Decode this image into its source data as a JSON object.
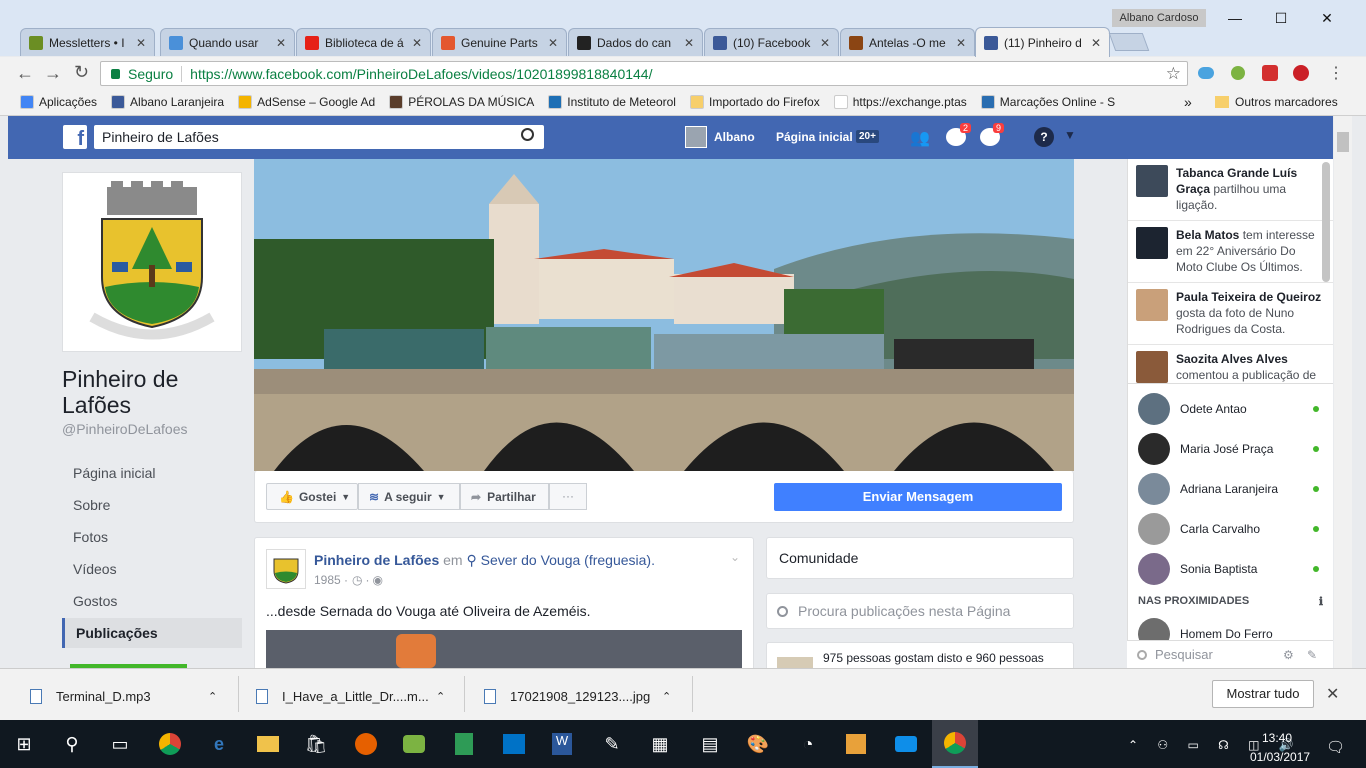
{
  "browser": {
    "profile_name": "Albano Cardoso",
    "tabs": [
      {
        "title": "Messletters • I",
        "icon": "messletters-icon",
        "color": "#6b8e23"
      },
      {
        "title": "Quando usar",
        "icon": "globe-icon",
        "color": "#4a90d9"
      },
      {
        "title": "Biblioteca de á",
        "icon": "youtube-icon",
        "color": "#e62117"
      },
      {
        "title": "Genuine Parts",
        "icon": "go-icon",
        "color": "#e4572e"
      },
      {
        "title": "Dados do can",
        "icon": "bars-icon",
        "color": "#222222"
      },
      {
        "title": "(10) Facebook",
        "icon": "facebook-icon",
        "color": "#3b5998"
      },
      {
        "title": "Antelas -O me",
        "icon": "antelas-icon",
        "color": "#8b4513"
      },
      {
        "title": "(11) Pinheiro d",
        "icon": "facebook-icon",
        "color": "#3b5998"
      }
    ],
    "secure_label": "Seguro",
    "url_prefix": "https://",
    "url_host": "www.facebook.com",
    "url_path": "/PinheiroDeLafoes/videos/10201899818840144/",
    "bookmarks": [
      {
        "label": "Aplicações",
        "color": "#4285f4"
      },
      {
        "label": "Albano Laranjeira",
        "color": "#3b5998"
      },
      {
        "label": "AdSense – Google Ad",
        "color": "#f4b400"
      },
      {
        "label": "PÉROLAS DA MÚSICA",
        "color": "#5a3d2b"
      },
      {
        "label": "Instituto de Meteorol",
        "color": "#1e6fb5"
      },
      {
        "label": "Importado do Firefox",
        "color": "#f7cf6b"
      },
      {
        "label": "https://exchange.ptas",
        "color": "#ffffff"
      },
      {
        "label": "Marcações Online - S",
        "color": "#2a6db0"
      }
    ],
    "bookmarks_more": "»",
    "other_bookmarks": "Outros marcadores"
  },
  "facebook": {
    "search_value": "Pinheiro de Lafões",
    "user_name": "Albano",
    "home_label": "Página inicial",
    "home_badge": "20+",
    "messages_badge": "2",
    "notifications_badge": "9",
    "page_name": "Pinheiro de Lafões",
    "page_handle": "@PinheiroDeLafoes",
    "nav": [
      "Página inicial",
      "Sobre",
      "Fotos",
      "Vídeos",
      "Gostos",
      "Publicações"
    ],
    "like_label": "Gostei",
    "follow_label": "A seguir",
    "share_label": "Partilhar",
    "more_label": "···",
    "message_label": "Enviar Mensagem",
    "post": {
      "author": "Pinheiro de Lafões",
      "in": "em",
      "location": "Sever do Vouga (freguesia).",
      "date": "1985 ·",
      "text": "...desde Sernada do Vouga até Oliveira de Azeméis."
    },
    "community_label": "Comunidade",
    "page_search_placeholder": "Procura publicações nesta Página",
    "likes_summary": "975 pessoas gostam disto e 960 pessoas"
  },
  "ticker": [
    {
      "name": "Tabanca Grande Luís Graça",
      "action": "partilhou uma ligação."
    },
    {
      "name": "Bela Matos",
      "action": "tem interesse em 22° Aniversário Do Moto Clube Os Últimos."
    },
    {
      "name": "Paula Teixeira de Queiroz",
      "action": "gosta da foto de Nuno Rodrigues da Costa."
    },
    {
      "name": "Saozita Alves Alves",
      "action": "comentou a publicação de"
    }
  ],
  "contacts": [
    "Odete Antao",
    "Maria José Praça",
    "Adriana Laranjeira",
    "Carla Carvalho",
    "Sonia Baptista"
  ],
  "nearby_label": "NAS PROXIMIDADES",
  "nearby_contact": "Homem Do Ferro",
  "chat_search_placeholder": "Pesquisar",
  "downloads": [
    {
      "name": "Terminal_D.mp3"
    },
    {
      "name": "I_Have_a_Little_Dr....m..."
    },
    {
      "name": "17021908_129123....jpg"
    }
  ],
  "show_all_label": "Mostrar tudo",
  "clock": {
    "time": "13:40",
    "date": "01/03/2017"
  }
}
